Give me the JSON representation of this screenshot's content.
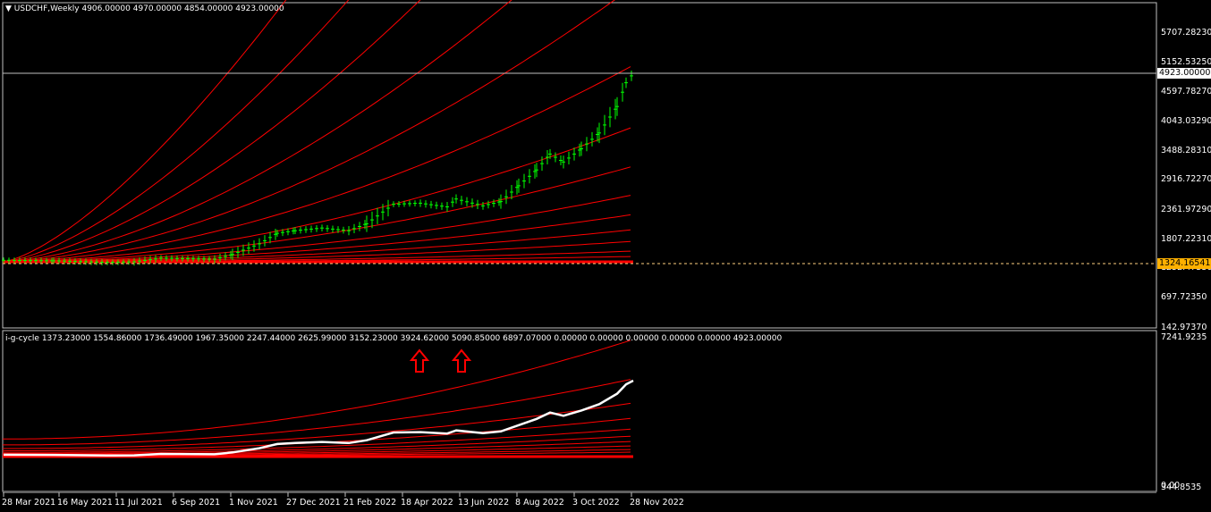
{
  "main": {
    "header": "USDCHF,Weekly  4906.00000 4970.00000 4854.00000 4923.00000",
    "price_labels": [
      "5707.28230",
      "5152.53250",
      "4597.78270",
      "4043.03290",
      "3488.28310",
      "2916.72270",
      "2361.97290",
      "1807.22310",
      "1252.47330",
      "697.72350",
      "142.97370"
    ],
    "current_price": "4923.00000",
    "level_price": "1324.16541",
    "colors": {
      "background": "#000000",
      "grid_lines": "#ff0000",
      "candles": "#00ff00",
      "level_line": "#ffd080",
      "current_line": "#c0c0c0"
    }
  },
  "indicator": {
    "header": "i-g-cycle 1373.23000 1554.86000 1736.49000 1967.35000 2247.44000 2625.99000 3152.23000 3924.62000 5090.85000 6897.07000 0.00000 0.00000 0.00000 0.00000 0.00000 4923.00000",
    "top_label": "7241.9235",
    "bottom_label_a": "0.00",
    "bottom_label_b": "344.8535"
  },
  "time_axis": [
    "28 Mar 2021",
    "16 May 2021",
    "11 Jul 2021",
    "6 Sep 2021",
    "1 Nov 2021",
    "27 Dec 2021",
    "21 Feb 2022",
    "18 Apr 2022",
    "13 Jun 2022",
    "8 Aug 2022",
    "3 Oct 2022",
    "28 Nov 2022"
  ],
  "chart_data": [
    {
      "type": "candlestick",
      "title": "USDCHF,Weekly",
      "ohlc_last": {
        "open": 4906.0,
        "high": 4970.0,
        "low": 4854.0,
        "close": 4923.0
      },
      "ylim": [
        142.9737,
        5707.2823
      ],
      "x": [
        "2021-03-28",
        "2021-05-16",
        "2021-07-11",
        "2021-09-06",
        "2021-10-04",
        "2021-11-01",
        "2021-11-15",
        "2021-12-27",
        "2022-02-21",
        "2022-04-11",
        "2022-04-18",
        "2022-06-13",
        "2022-07-04",
        "2022-08-08",
        "2022-08-29",
        "2022-09-12",
        "2022-10-03",
        "2022-10-31",
        "2022-11-14",
        "2022-11-28"
      ],
      "close": [
        1390,
        1370,
        1360,
        1400,
        1480,
        1900,
        2050,
        1980,
        2150,
        2520,
        2480,
        2600,
        2500,
        3000,
        3450,
        3150,
        3650,
        4150,
        4600,
        4923
      ]
    },
    {
      "type": "line",
      "title": "i-g-cycle",
      "levels": [
        1373.23,
        1554.86,
        1736.49,
        1967.35,
        2247.44,
        2625.99,
        3152.23,
        3924.62,
        5090.85,
        6897.07,
        0,
        0,
        0,
        0,
        0,
        4923.0
      ],
      "ylim": [
        0,
        7241.9235
      ]
    }
  ]
}
